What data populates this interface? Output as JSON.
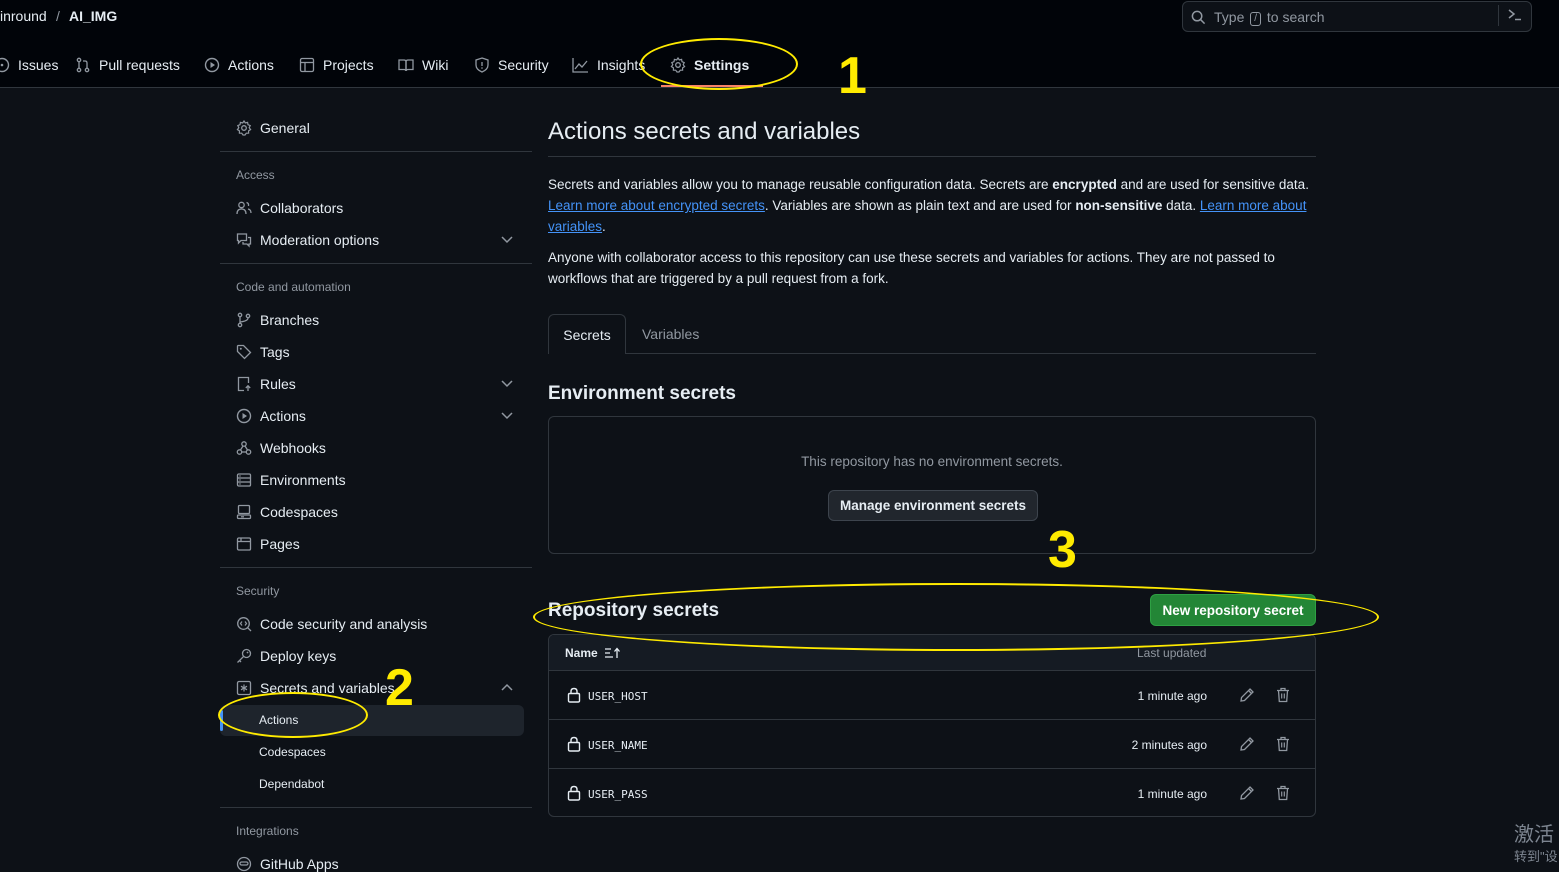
{
  "header": {
    "owner": "inround",
    "separator": "/",
    "repo": "AI_IMG",
    "search_placeholder_prefix": "Type",
    "search_key": "/",
    "search_placeholder_suffix": "to search",
    "tabs": [
      {
        "label": "Issues",
        "icon": "issue-icon"
      },
      {
        "label": "Pull requests",
        "icon": "pull-request-icon"
      },
      {
        "label": "Actions",
        "icon": "play-icon"
      },
      {
        "label": "Projects",
        "icon": "table-icon"
      },
      {
        "label": "Wiki",
        "icon": "book-icon"
      },
      {
        "label": "Security",
        "icon": "shield-icon"
      },
      {
        "label": "Insights",
        "icon": "graph-icon"
      },
      {
        "label": "Settings",
        "icon": "gear-icon",
        "active": true
      }
    ]
  },
  "sidebar": {
    "general": "General",
    "access_heading": "Access",
    "collaborators": "Collaborators",
    "moderation": "Moderation options",
    "code_heading": "Code and automation",
    "branches": "Branches",
    "tags": "Tags",
    "rules": "Rules",
    "actions": "Actions",
    "webhooks": "Webhooks",
    "environments": "Environments",
    "codespaces": "Codespaces",
    "pages": "Pages",
    "security_heading": "Security",
    "code_security": "Code security and analysis",
    "deploy_keys": "Deploy keys",
    "secrets_vars": "Secrets and variables",
    "sub_actions": "Actions",
    "sub_codespaces": "Codespaces",
    "sub_dependabot": "Dependabot",
    "integrations_heading": "Integrations",
    "github_apps": "GitHub Apps"
  },
  "main": {
    "title": "Actions secrets and variables",
    "p1_a": "Secrets and variables allow you to manage reusable configuration data. Secrets are ",
    "p1_b": "encrypted",
    "p1_c": " and are used for sensitive data. ",
    "p1_link1": "Learn more about encrypted secrets",
    "p1_d": ". Variables are shown as plain text and are used for ",
    "p1_e": "non-sensitive",
    "p1_f": " data. ",
    "p1_link2": "Learn more about variables",
    "p1_g": ".",
    "p2": "Anyone with collaborator access to this repository can use these secrets and variables for actions. They are not passed to workflows that are triggered by a pull request from a fork.",
    "tab_secrets": "Secrets",
    "tab_variables": "Variables",
    "env_title": "Environment secrets",
    "env_empty": "This repository has no environment secrets.",
    "env_button": "Manage environment secrets",
    "repo_title": "Repository secrets",
    "new_button": "New repository secret",
    "col_name": "Name",
    "col_updated": "Last updated",
    "secrets": [
      {
        "name": "USER_HOST",
        "updated": "1 minute ago"
      },
      {
        "name": "USER_NAME",
        "updated": "2 minutes ago"
      },
      {
        "name": "USER_PASS",
        "updated": "1 minute ago"
      }
    ]
  },
  "annotations": {
    "n1": "1",
    "n2": "2",
    "n3": "3",
    "color": "#ffeb00"
  },
  "watermark": {
    "line1": "激活",
    "line2": "转到\"设"
  },
  "colors": {
    "accent": "#4493f8",
    "primary_button": "#238636",
    "active_tab_underline": "#f78166"
  }
}
